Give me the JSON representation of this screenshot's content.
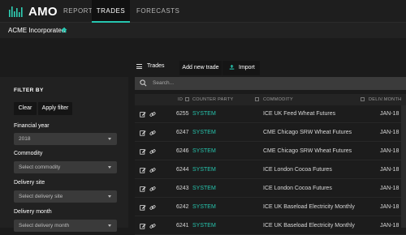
{
  "app": {
    "logo_text": "AMO"
  },
  "nav": {
    "tabs": [
      {
        "label": "REPORTS"
      },
      {
        "label": "TRADES"
      },
      {
        "label": "FORECASTS"
      }
    ],
    "active": "TRADES"
  },
  "breadcrumb": {
    "company": "ACME Incorporated"
  },
  "sidebar": {
    "title": "FILTER BY",
    "clear_label": "Clear",
    "apply_label": "Apply filter",
    "fields": [
      {
        "label": "Financial year",
        "value": "2018"
      },
      {
        "label": "Commodity",
        "value": "Select commodity"
      },
      {
        "label": "Delivery site",
        "value": "Select delivery site"
      },
      {
        "label": "Delivery month",
        "value": "Select delivery month"
      }
    ]
  },
  "trades": {
    "title": "Trades",
    "add_label": "Add new trade",
    "import_label": "Import",
    "search_placeholder": "Search...",
    "columns": [
      "ID",
      "COUNTER PARTY",
      "COMMODITY",
      "DELIV.MONTH"
    ],
    "rows": [
      {
        "id": "6255",
        "counterparty": "SYSTEM",
        "commodity": "ICE UK Feed Wheat Futures",
        "month": "JAN-18"
      },
      {
        "id": "6247",
        "counterparty": "SYSTEM",
        "commodity": "CME Chicago SRW Wheat Futures",
        "month": "JAN-18"
      },
      {
        "id": "6246",
        "counterparty": "SYSTEM",
        "commodity": "CME Chicago SRW Wheat Futures",
        "month": "JAN-18"
      },
      {
        "id": "6244",
        "counterparty": "SYSTEM",
        "commodity": "ICE London Cocoa Futures",
        "month": "JAN-18"
      },
      {
        "id": "6243",
        "counterparty": "SYSTEM",
        "commodity": "ICE London Cocoa Futures",
        "month": "JAN-18"
      },
      {
        "id": "6242",
        "counterparty": "SYSTEM",
        "commodity": "ICE UK Baseload Electricity Monthly",
        "month": "JAN-18"
      },
      {
        "id": "6241",
        "counterparty": "SYSTEM",
        "commodity": "ICE UK Baseload Electricity Monthly",
        "month": "JAN-18"
      }
    ]
  },
  "colors": {
    "accent": "#26c6b0",
    "background": "#1b1b1b"
  }
}
